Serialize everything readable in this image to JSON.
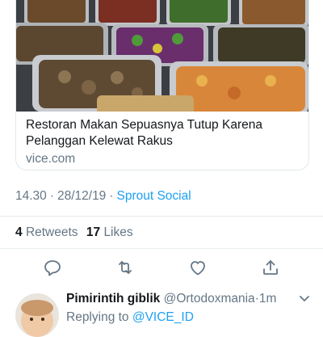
{
  "card": {
    "image_alt": "buffet trays of assorted Indonesian dishes",
    "title": "Restoran Makan Sepuasnya Tutup Karena Pelanggan Kelewat Rakus",
    "domain": "vice.com"
  },
  "meta": {
    "time": "14.30",
    "separator": "·",
    "date": "28/12/19",
    "source": "Sprout Social"
  },
  "stats": {
    "retweets_count": "4",
    "retweets_label": "Retweets",
    "likes_count": "17",
    "likes_label": "Likes"
  },
  "actions": {
    "icons": [
      "reply-icon",
      "retweet-icon",
      "like-icon",
      "share-icon"
    ],
    "color": "#657786"
  },
  "reply": {
    "name": "Pimirintih giblik",
    "handle": "@Ortodoxmania",
    "dot": "·",
    "time": "1m",
    "replying_to_label": "Replying to",
    "replying_to_user": "@VICE_ID"
  },
  "colors": {
    "link": "#1da1f2",
    "muted": "#657786",
    "text": "#14171a",
    "border": "#e1e8ed"
  }
}
